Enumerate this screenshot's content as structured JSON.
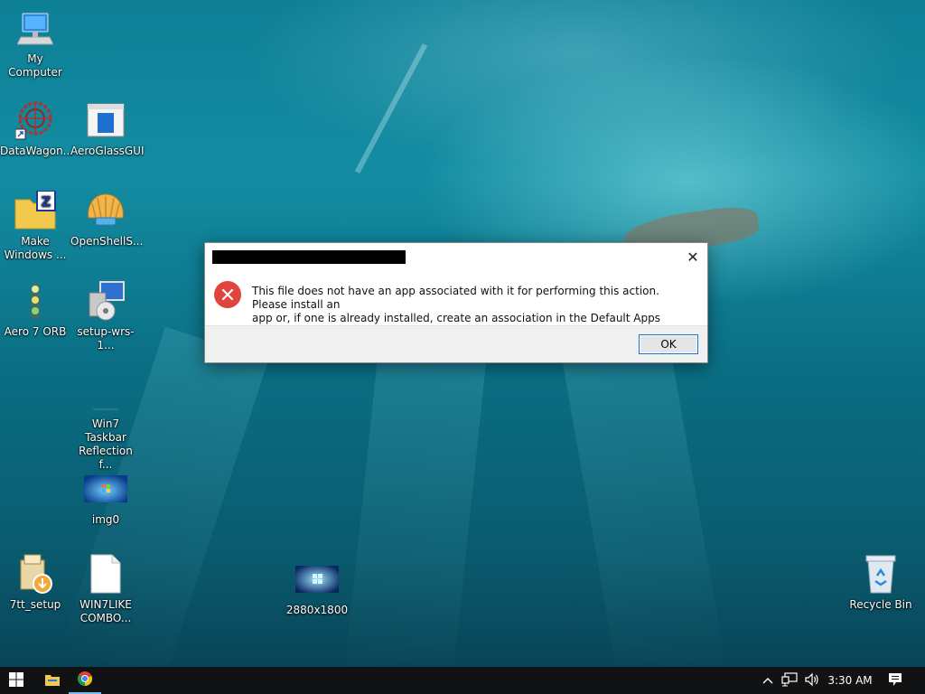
{
  "desktop": {
    "icons": {
      "my_computer": "My Computer",
      "datawagon": "DataWagon...",
      "aeroglassgui": "AeroGlassGUI",
      "make_windows_1": "Make",
      "make_windows_2": "Windows ...",
      "openshell": "OpenShellS...",
      "aero7orb": "Aero 7 ORB",
      "setup_wrs": "setup-wrs-1...",
      "win7_taskbar_1": "Win7 Taskbar",
      "win7_taskbar_2": "Reflection f...",
      "img0": "img0",
      "tt_setup": "7tt_setup",
      "win7like_1": "WIN7LIKE",
      "win7like_2": "COMBO...",
      "wallpaper_2880": "2880x1800",
      "recycle_bin": "Recycle Bin"
    }
  },
  "dialog": {
    "message_line1": "This file does not have an app associated with it for performing this action. Please install an",
    "message_line2": "app or, if one is already installed, create an association in the Default Apps Settings page.",
    "ok_label": "OK",
    "close_glyph": "✕",
    "icon": "error-icon"
  },
  "taskbar": {
    "time": "3:30 AM",
    "pinned": [
      "start-icon",
      "file-explorer-icon",
      "chrome-icon"
    ],
    "tray": [
      "chevron-up-icon",
      "network-icon",
      "volume-icon",
      "notification-icon"
    ]
  },
  "colors": {
    "error_red": "#e0443a",
    "accent_blue": "#1a73d4",
    "taskbar_bg": "#101214"
  }
}
